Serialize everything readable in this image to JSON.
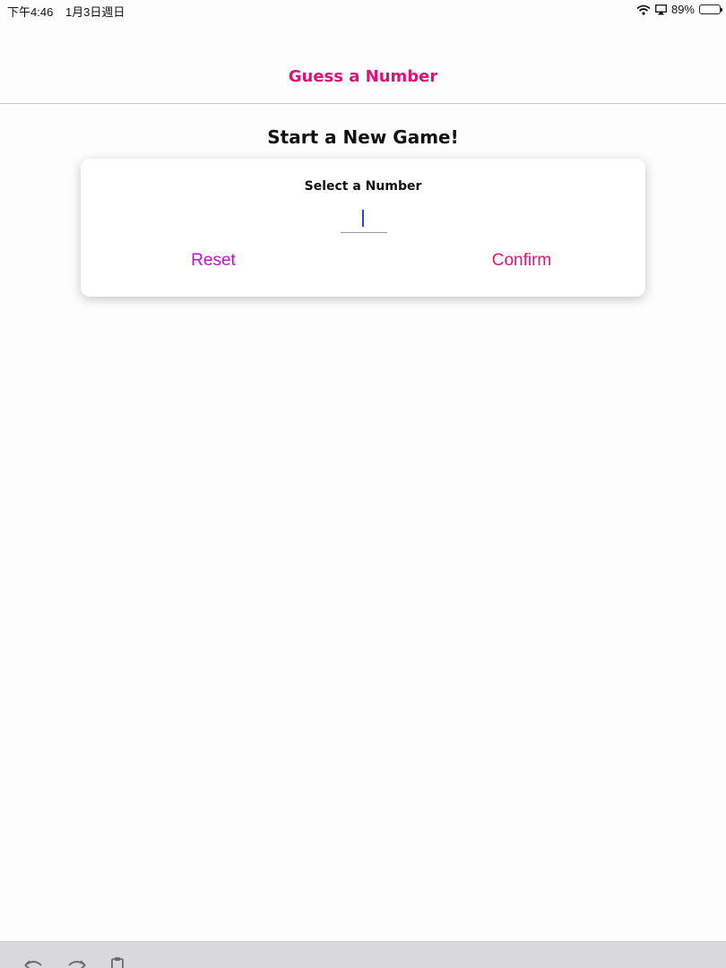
{
  "status_bar": {
    "time": "下午4:46",
    "date": "1月3日週日",
    "battery": "89%"
  },
  "header": {
    "title": "Guess a Number"
  },
  "game": {
    "title": "Start a New Game!",
    "card": {
      "label": "Select a Number",
      "input_value": "",
      "reset_label": "Reset",
      "confirm_label": "Confirm"
    }
  },
  "colors": {
    "accent": "#e0117a",
    "reset": "#c20fd8",
    "cursor": "#2f3cff"
  },
  "icons": {
    "status": [
      "wifi-icon",
      "airplay-icon",
      "battery-icon"
    ],
    "toolbar": [
      "undo-icon",
      "redo-icon",
      "clipboard-icon"
    ]
  }
}
